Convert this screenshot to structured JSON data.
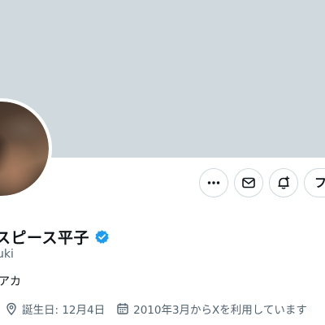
{
  "profile": {
    "display_name": "スピース平子",
    "handle": "uki",
    "bio": "アカ",
    "verified_icon": "verified-badge-icon",
    "verified_color": "#1d9bf0",
    "banner_color": "#cfd9de"
  },
  "actions": {
    "more_icon": "more-icon",
    "message_icon": "message-icon",
    "notify_icon": "notification-bell-icon",
    "follow_label": "フ"
  },
  "meta": {
    "birthday_label": "誕生日: 12月4日",
    "joined_label": "2010年3月からXを利用しています",
    "location_icon": "location-pin-icon",
    "calendar_icon": "calendar-icon"
  }
}
